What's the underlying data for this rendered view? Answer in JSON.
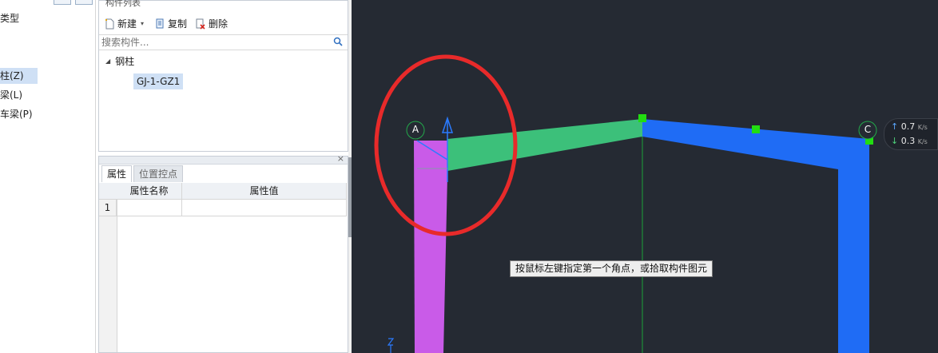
{
  "left_panel": {
    "items": [
      {
        "label": "类型",
        "selected": false
      },
      {
        "label": "柱(Z)",
        "selected": true
      },
      {
        "label": "梁(L)",
        "selected": false
      },
      {
        "label": "车梁(P)",
        "selected": false
      }
    ]
  },
  "component_list": {
    "title": "构件列表",
    "toolbar": {
      "new_label": "新建",
      "copy_label": "复制",
      "delete_label": "删除"
    },
    "search_placeholder": "搜索构件...",
    "tree": {
      "root_label": "钢柱",
      "child_label": "GJ-1-GZ1"
    }
  },
  "properties": {
    "close_symbol": "×",
    "tabs": [
      {
        "label": "属性",
        "active": true
      },
      {
        "label": "位置控点",
        "active": false
      }
    ],
    "columns": [
      "属性名称",
      "属性值"
    ],
    "rows": [
      {
        "index": "1",
        "name": "",
        "value": ""
      }
    ]
  },
  "canvas": {
    "axis_labels": [
      "A",
      "C"
    ],
    "prompt": "按鼠标左键指定第一个角点，或拾取构件图元",
    "network": {
      "up_value": "0.7",
      "down_value": "0.3",
      "unit": "K/s"
    },
    "colors": {
      "background": "#252a33",
      "column": "#c95be8",
      "beam_green": "#3cc07a",
      "frame_blue": "#1f6cf5",
      "grip": "#22dd11",
      "annotation_circle": "#e82a2a"
    }
  }
}
